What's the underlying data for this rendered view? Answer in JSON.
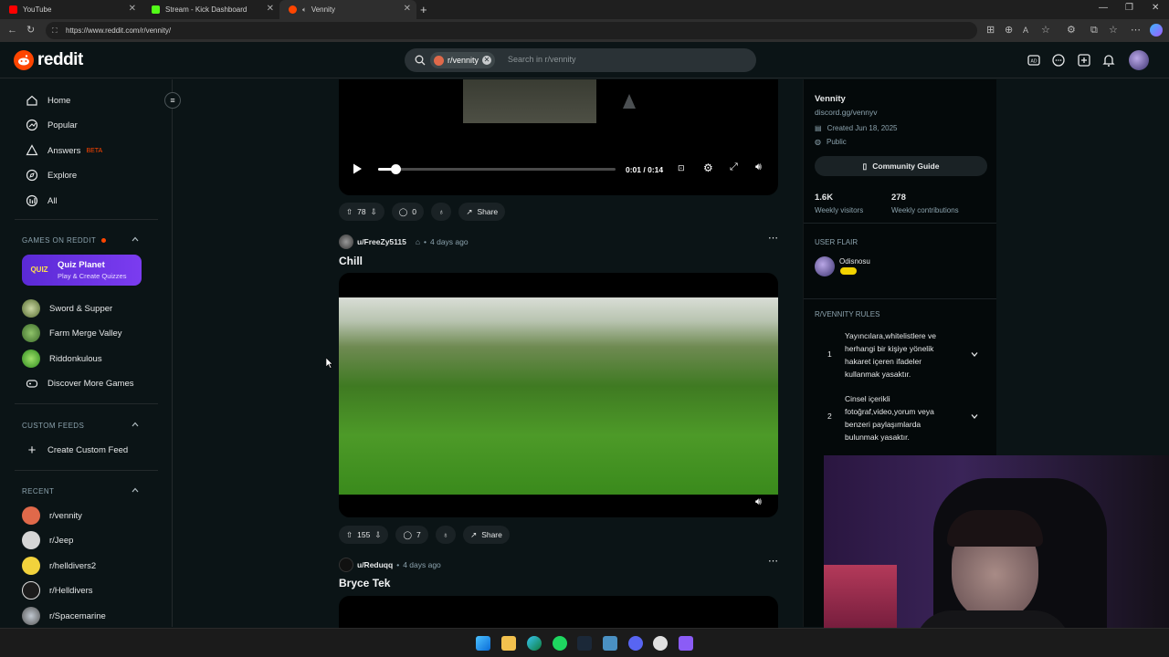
{
  "browser": {
    "tabs": [
      {
        "title": "YouTube",
        "color": "#ff0000"
      },
      {
        "title": "Stream - Kick Dashboard",
        "color": "#53fc18"
      },
      {
        "title": "Vennity",
        "color": "#ff4500"
      }
    ],
    "url": "https://www.reddit.com/r/vennity/"
  },
  "header": {
    "logo_text": "reddit",
    "search_chip": "r/vennity",
    "search_placeholder": "Search in r/vennity"
  },
  "sidebar": {
    "nav": [
      {
        "label": "Home",
        "icon": "home-icon"
      },
      {
        "label": "Popular",
        "icon": "popular-icon"
      },
      {
        "label": "Answers",
        "icon": "answers-icon",
        "badge": "BETA"
      },
      {
        "label": "Explore",
        "icon": "explore-icon"
      },
      {
        "label": "All",
        "icon": "all-icon"
      }
    ],
    "games_heading": "GAMES ON REDDIT",
    "featured_game": {
      "badge": "QUIZ",
      "title": "Quiz Planet",
      "subtitle": "Play & Create Quizzes"
    },
    "games": [
      "Sword & Supper",
      "Farm Merge Valley",
      "Riddonkulous"
    ],
    "discover_label": "Discover More Games",
    "custom_feeds_heading": "CUSTOM FEEDS",
    "create_feed_label": "Create Custom Feed",
    "recent_heading": "RECENT",
    "recent": [
      "r/vennity",
      "r/Jeep",
      "r/helldivers2",
      "r/Helldivers",
      "r/Spacemarine"
    ]
  },
  "feed": {
    "post1": {
      "player": {
        "time": "0:01 / 0:14",
        "progress": 0.0714
      },
      "votes": "78",
      "comments": "0",
      "share_label": "Share"
    },
    "post2": {
      "author": "u/FreeZy5115",
      "time": "4 days ago",
      "title": "Chill",
      "votes": "155",
      "comments": "7",
      "share_label": "Share"
    },
    "post3": {
      "author": "u/Reduqq",
      "time": "4 days ago",
      "title": "Bryce Tek"
    }
  },
  "community": {
    "name": "Vennity",
    "link": "discord.gg/vennyv",
    "created": "Created Jun 18, 2025",
    "visibility": "Public",
    "guide_label": "Community Guide",
    "stats": [
      {
        "value": "1.6K",
        "label": "Weekly visitors"
      },
      {
        "value": "278",
        "label": "Weekly contributions"
      }
    ],
    "flair_heading": "USER FLAIR",
    "flair_user": "Odisnosu",
    "rules_heading": "R/VENNITY RULES",
    "rules": [
      {
        "num": "1",
        "text": "Yayıncılara,whitelistlere ve herhangi bir kişiye yönelik hakaret içeren ifadeler kullanmak yasaktır."
      },
      {
        "num": "2",
        "text": "Cinsel içerikli fotoğraf,video,yorum veya benzeri paylaşımlarda bulunmak yasaktır."
      }
    ]
  },
  "colors": {
    "accent": "#ff4500",
    "bg": "#0b1416",
    "beta": "#ff4500"
  }
}
